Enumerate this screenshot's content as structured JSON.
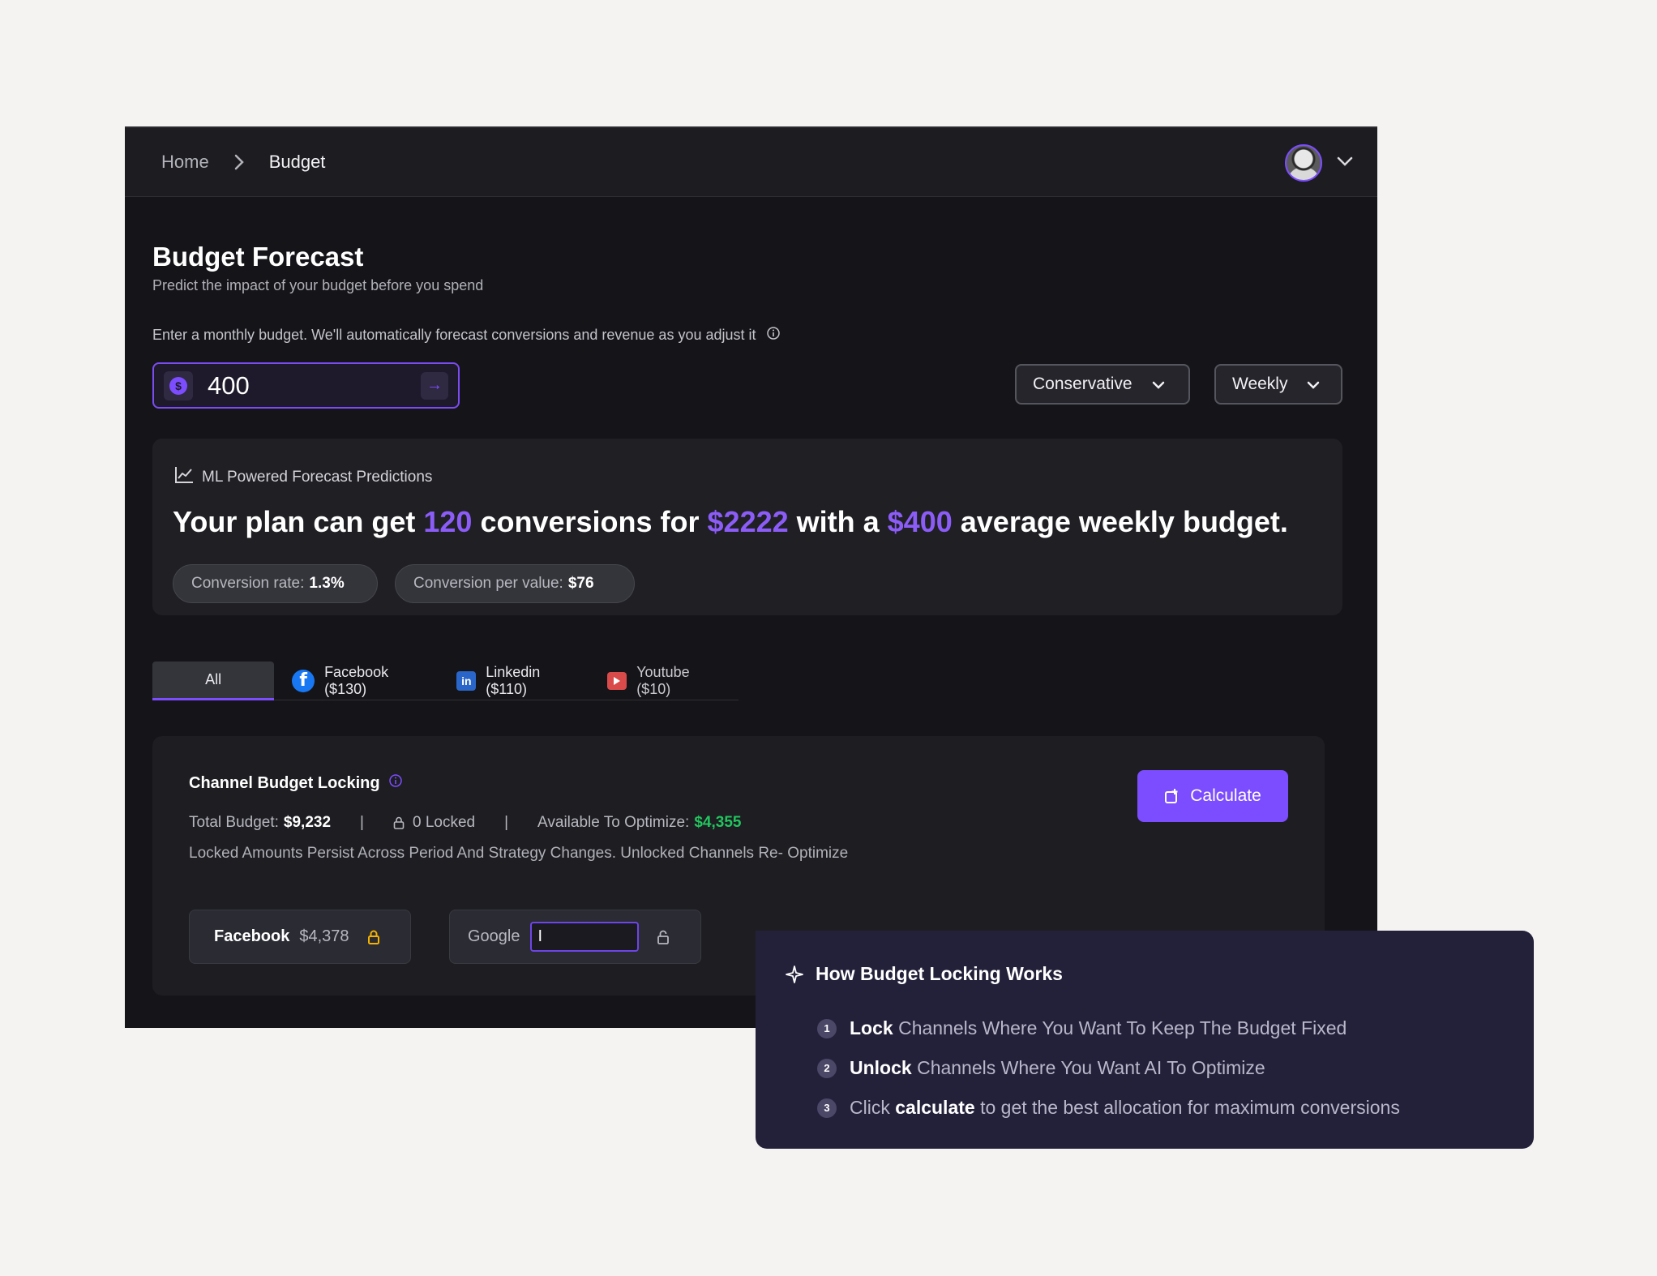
{
  "breadcrumb": {
    "home": "Home",
    "current": "Budget"
  },
  "page": {
    "title": "Budget Forecast",
    "subtitle": "Predict the impact of your budget before you spend",
    "hint": "Enter a monthly budget. We'll automatically forecast conversions and revenue as you adjust it"
  },
  "budget_input": {
    "value": "400",
    "currency_icon": "dollar-icon"
  },
  "selects": {
    "strategy": "Conservative",
    "period": "Weekly"
  },
  "forecast": {
    "label": "ML Powered Forecast Predictions",
    "headline_parts": {
      "p1": "Your plan can get ",
      "conversions": "120",
      "p2": " conversions for ",
      "revenue": "$2222",
      "p3": " with a ",
      "budget": "$400",
      "p4": " average weekly budget."
    },
    "conversion_rate_label": "Conversion rate:",
    "conversion_rate_value": "1.3%",
    "conversion_value_label": "Conversion per value:",
    "conversion_value_value": "$76"
  },
  "tabs": [
    {
      "label": "All"
    },
    {
      "label": "Facebook ($130)"
    },
    {
      "label": "Linkedin ($110)"
    },
    {
      "label": "Youtube ($10)"
    }
  ],
  "locking": {
    "title": "Channel Budget Locking",
    "total_label": "Total Budget:",
    "total_value": "$9,232",
    "sep": "|",
    "locked_text": "0 Locked",
    "available_label": "Available To Optimize:",
    "available_value": "$4,355",
    "note": "Locked Amounts Persist Across Period And Strategy Changes. Unlocked Channels Re- Optimize",
    "calculate_label": "Calculate",
    "channels": [
      {
        "name": "Facebook",
        "amount": "$4,378"
      },
      {
        "name": "Google",
        "input_value": "I"
      }
    ]
  },
  "how": {
    "title": "How Budget Locking Works",
    "steps": [
      {
        "num": "1",
        "bold": "Lock",
        "rest": " Channels Where You Want To Keep The Budget Fixed"
      },
      {
        "num": "2",
        "bold": "Unlock",
        "rest": " Channels Where You Want AI To Optimize"
      },
      {
        "num": "3",
        "pre": "Click ",
        "bold": "calculate",
        "rest": " to get the best allocation for maximum conversions"
      }
    ]
  },
  "colors": {
    "accent": "#7c4dff",
    "green": "#22c55e",
    "lock_yellow": "#f5b301"
  }
}
